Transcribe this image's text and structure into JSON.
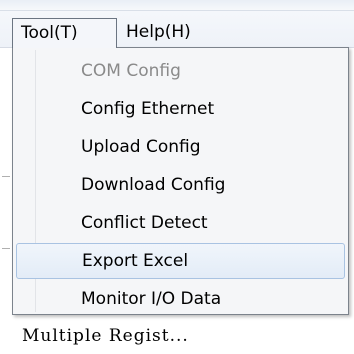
{
  "menubar": {
    "items": [
      {
        "label": "Tool(T)"
      },
      {
        "label": "Help(H)"
      }
    ]
  },
  "tool_menu": {
    "items": [
      {
        "label": "COM Config",
        "enabled": false
      },
      {
        "label": "Config Ethernet",
        "enabled": true
      },
      {
        "label": "Upload Config",
        "enabled": true
      },
      {
        "label": "Download Config",
        "enabled": true
      },
      {
        "label": "Conflict Detect",
        "enabled": true
      },
      {
        "label": "Export Excel",
        "enabled": true,
        "hovered": true
      },
      {
        "label": "Monitor I/O Data",
        "enabled": true
      }
    ]
  },
  "background": {
    "partial_text": "Multiple Regist..."
  },
  "colors": {
    "highlight_border": "#a9c3e2",
    "disabled_text": "#8a8a8a",
    "menu_border": "#7c838c"
  }
}
